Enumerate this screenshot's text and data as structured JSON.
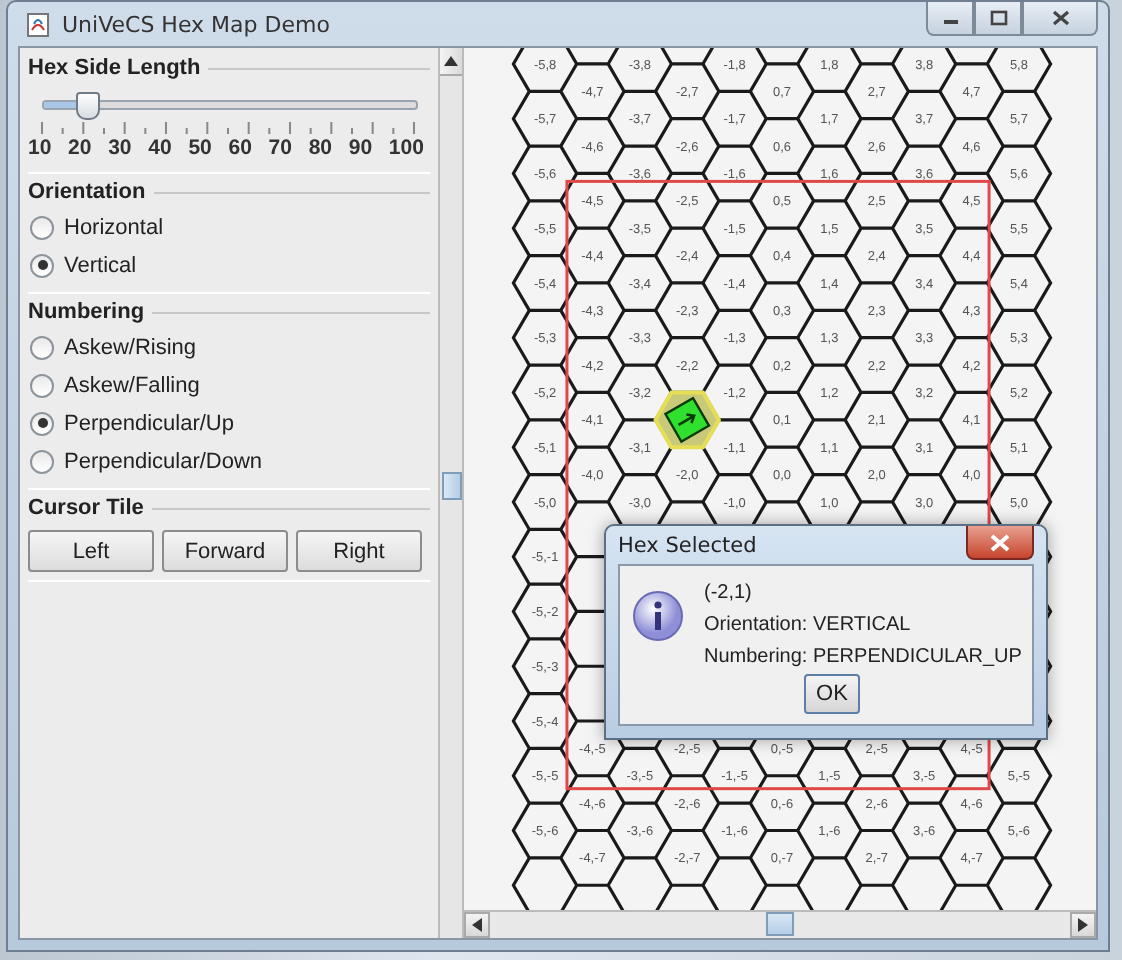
{
  "window": {
    "title": "UniVeCS Hex Map Demo"
  },
  "hex_side_length": {
    "title": "Hex Side Length",
    "level": 0.111,
    "ticks": [
      "10",
      "20",
      "30",
      "40",
      "50",
      "60",
      "70",
      "80",
      "90",
      "100"
    ]
  },
  "orientation": {
    "title": "Orientation",
    "options": [
      {
        "label": "Horizontal",
        "selected": false
      },
      {
        "label": "Vertical",
        "selected": true
      }
    ]
  },
  "numbering": {
    "title": "Numbering",
    "options": [
      {
        "label": "Askew/Rising",
        "selected": false
      },
      {
        "label": "Askew/Falling",
        "selected": false
      },
      {
        "label": "Perpendicular/Up",
        "selected": true
      },
      {
        "label": "Perpendicular/Down",
        "selected": false
      }
    ]
  },
  "cursor_tile": {
    "title": "Cursor Tile",
    "buttons": [
      "Left",
      "Forward",
      "Right"
    ]
  },
  "hex_map": {
    "columns": [
      {
        "cells": [
          {
            "label": "-5,8",
            "selected": false
          },
          {
            "label": "-5,7",
            "selected": false
          },
          {
            "label": "-5,6",
            "selected": false
          },
          {
            "label": "-5,5",
            "selected": false
          },
          {
            "label": "-5,4",
            "selected": false
          },
          {
            "label": "-5,3",
            "selected": false
          },
          {
            "label": "-5,2",
            "selected": false
          },
          {
            "label": "-5,1",
            "selected": false
          },
          {
            "label": "-5,0",
            "selected": false
          },
          {
            "label": "-5,-1",
            "selected": false
          },
          {
            "label": "-5,-2",
            "selected": false
          },
          {
            "label": "-5,-3",
            "selected": false
          },
          {
            "label": "-5,-4",
            "selected": false
          },
          {
            "label": "-5,-5",
            "selected": false
          },
          {
            "label": "-5,-6",
            "selected": false
          }
        ]
      },
      {
        "cells": [
          {
            "label": "-4,7",
            "selected": false
          },
          {
            "label": "-4,6",
            "selected": false
          },
          {
            "label": "-4,5",
            "selected": false
          },
          {
            "label": "-4,4",
            "selected": false
          },
          {
            "label": "-4,3",
            "selected": false
          },
          {
            "label": "-4,2",
            "selected": false
          },
          {
            "label": "-4,1",
            "selected": false
          },
          {
            "label": "-4,0",
            "selected": false
          }
        ],
        "lower_cells": [
          {
            "label": "-4,-5",
            "selected": false
          },
          {
            "label": "-4,-6",
            "selected": false
          },
          {
            "label": "-4,-7",
            "selected": false
          }
        ]
      },
      {
        "cells": [
          {
            "label": "-3,8",
            "selected": false
          },
          {
            "label": "-3,7",
            "selected": false
          },
          {
            "label": "-3,6",
            "selected": false
          },
          {
            "label": "-3,5",
            "selected": false
          },
          {
            "label": "-3,4",
            "selected": false
          },
          {
            "label": "-3,3",
            "selected": false
          },
          {
            "label": "-3,2",
            "selected": false
          },
          {
            "label": "-3,1",
            "selected": false
          },
          {
            "label": "-3,0",
            "selected": false
          }
        ],
        "lower_cells": [
          {
            "label": "-3,-5",
            "selected": false
          },
          {
            "label": "-3,-6",
            "selected": false
          }
        ]
      },
      {
        "cells": [
          {
            "label": "-2,7",
            "selected": false
          },
          {
            "label": "-2,6",
            "selected": false
          },
          {
            "label": "-2,5",
            "selected": false
          },
          {
            "label": "-2,4",
            "selected": false
          },
          {
            "label": "-2,3",
            "selected": false
          },
          {
            "label": "-2,2",
            "selected": false
          },
          {
            "selected": true
          },
          {
            "label": "-2,0",
            "selected": false
          }
        ],
        "lower_cells": [
          {
            "label": "-2,-5",
            "selected": false
          },
          {
            "label": "-2,-6",
            "selected": false
          },
          {
            "label": "-2,-7",
            "selected": false
          }
        ]
      },
      {
        "cells": [
          {
            "label": "-1,8",
            "selected": false
          },
          {
            "label": "-1,7",
            "selected": false
          },
          {
            "label": "-1,6",
            "selected": false
          },
          {
            "label": "-1,5",
            "selected": false
          },
          {
            "label": "-1,4",
            "selected": false
          },
          {
            "label": "-1,3",
            "selected": false
          },
          {
            "label": "-1,2",
            "selected": false
          },
          {
            "label": "-1,1",
            "selected": false
          },
          {
            "label": "-1,0",
            "selected": false
          }
        ],
        "lower_cells": [
          {
            "label": "-1,-5",
            "selected": false
          },
          {
            "label": "-1,-6",
            "selected": false
          }
        ]
      },
      {
        "cells": [
          {
            "label": "0,7",
            "selected": false
          },
          {
            "label": "0,6",
            "selected": false
          },
          {
            "label": "0,5",
            "selected": false
          },
          {
            "label": "0,4",
            "selected": false
          },
          {
            "label": "0,3",
            "selected": false
          },
          {
            "label": "0,2",
            "selected": false
          },
          {
            "label": "0,1",
            "selected": false
          },
          {
            "label": "0,0",
            "selected": false
          }
        ],
        "lower_cells": [
          {
            "label": "0,-5",
            "selected": false
          },
          {
            "label": "0,-6",
            "selected": false
          },
          {
            "label": "0,-7",
            "selected": false
          }
        ]
      },
      {
        "cells": [
          {
            "label": "1,8",
            "selected": false
          },
          {
            "label": "1,7",
            "selected": false
          },
          {
            "label": "1,6",
            "selected": false
          },
          {
            "label": "1,5",
            "selected": false
          },
          {
            "label": "1,4",
            "selected": false
          },
          {
            "label": "1,3",
            "selected": false
          },
          {
            "label": "1,2",
            "selected": false
          },
          {
            "label": "1,1",
            "selected": false
          },
          {
            "label": "1,0",
            "selected": false
          }
        ],
        "lower_cells": [
          {
            "label": "1,-5",
            "selected": false
          },
          {
            "label": "1,-6",
            "selected": false
          }
        ]
      },
      {
        "cells": [
          {
            "label": "2,7",
            "selected": false
          },
          {
            "label": "2,6",
            "selected": false
          },
          {
            "label": "2,5",
            "selected": false
          },
          {
            "label": "2,4",
            "selected": false
          },
          {
            "label": "2,3",
            "selected": false
          },
          {
            "label": "2,2",
            "selected": false
          },
          {
            "label": "2,1",
            "selected": false
          },
          {
            "label": "2,0",
            "selected": false
          }
        ],
        "lower_cells": [
          {
            "label": "2,-5",
            "selected": false
          },
          {
            "label": "2,-6",
            "selected": false
          },
          {
            "label": "2,-7",
            "selected": false
          }
        ]
      },
      {
        "cells": [
          {
            "label": "3,8",
            "selected": false
          },
          {
            "label": "3,7",
            "selected": false
          },
          {
            "label": "3,6",
            "selected": false
          },
          {
            "label": "3,5",
            "selected": false
          },
          {
            "label": "3,4",
            "selected": false
          },
          {
            "label": "3,3",
            "selected": false
          },
          {
            "label": "3,2",
            "selected": false
          },
          {
            "label": "3,1",
            "selected": false
          },
          {
            "label": "3,0",
            "selected": false
          }
        ],
        "lower_cells": [
          {
            "label": "3,-5",
            "selected": false
          },
          {
            "label": "3,-6",
            "selected": false
          }
        ]
      },
      {
        "cells": [
          {
            "label": "4,7",
            "selected": false
          },
          {
            "label": "4,6",
            "selected": false
          },
          {
            "label": "4,5",
            "selected": false
          },
          {
            "label": "4,4",
            "selected": false
          },
          {
            "label": "4,3",
            "selected": false
          },
          {
            "label": "4,2",
            "selected": false
          },
          {
            "label": "4,1",
            "selected": false
          },
          {
            "label": "4,0",
            "selected": false
          }
        ],
        "lower_cells": [
          {
            "label": "4,-5",
            "selected": false
          },
          {
            "label": "4,-6",
            "selected": false
          },
          {
            "label": "4,-7",
            "selected": false
          }
        ]
      },
      {
        "cells": [
          {
            "label": "5,8",
            "selected": false
          },
          {
            "label": "5,7",
            "selected": false
          },
          {
            "label": "5,6",
            "selected": false
          },
          {
            "label": "5,5",
            "selected": false
          },
          {
            "label": "5,4",
            "selected": false
          },
          {
            "label": "5,3",
            "selected": false
          },
          {
            "label": "5,2",
            "selected": false
          },
          {
            "label": "5,1",
            "selected": false
          },
          {
            "label": "5,0",
            "selected": false
          }
        ],
        "lower_cells": [
          {
            "label": "5,-5",
            "selected": false
          },
          {
            "label": "5,-6",
            "selected": false
          }
        ]
      }
    ]
  },
  "dialog": {
    "title": "Hex Selected",
    "lines": [
      "(-2,1)",
      "Orientation: VERTICAL",
      "Numbering: PERPENDICULAR_UP"
    ],
    "button": "OK"
  }
}
